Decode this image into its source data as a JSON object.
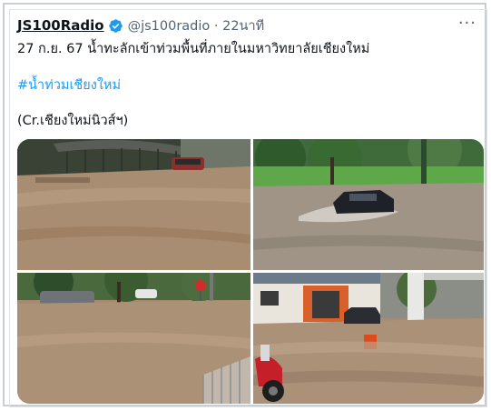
{
  "tweet": {
    "display_name": "JS100Radio",
    "handle_time": "@js100radio · 22นาที",
    "more_label": "···",
    "line1": "27 ก.ย. 67 น้ำทะลักเข้าท่วมพื้นที่ภายในมหาวิทยาลัยเชียงใหม่",
    "hashtag": "#น้ำท่วมเชียงใหม่",
    "credit": "(Cr.เชียงใหม่นิวส์ฯ)"
  },
  "icons": {
    "verified": "verified-badge-icon",
    "more": "more-options-icon"
  },
  "colors": {
    "verified_blue": "#1d9bf0",
    "hashtag_blue": "#1d9bf0",
    "text": "#0f1419",
    "secondary_text": "#536471",
    "floodwater": "#a98c6e"
  },
  "media": {
    "photos": [
      {
        "id": "photo-1",
        "alt": "flooded road under covered walkway with red car"
      },
      {
        "id": "photo-2",
        "alt": "dark car driving through flooded road near lawn"
      },
      {
        "id": "photo-3",
        "alt": "flooded street with parked cars and stop sign"
      },
      {
        "id": "photo-4",
        "alt": "flooded building entrance with red scooter"
      }
    ]
  }
}
